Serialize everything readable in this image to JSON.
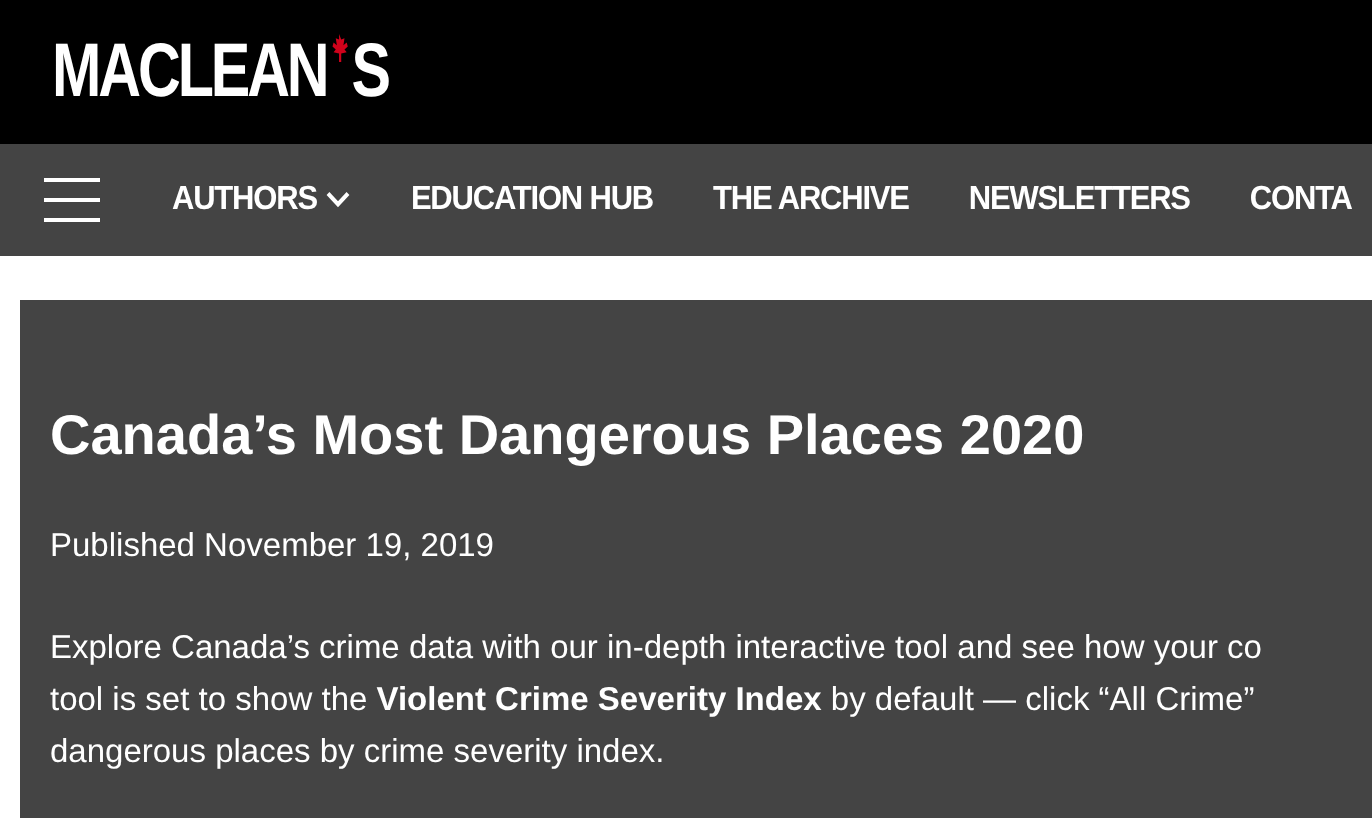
{
  "logo": {
    "text_before": "MACLEAN",
    "text_after": "S"
  },
  "nav": {
    "items": [
      {
        "label": "AUTHORS",
        "has_dropdown": true
      },
      {
        "label": "EDUCATION HUB",
        "has_dropdown": false
      },
      {
        "label": "THE ARCHIVE",
        "has_dropdown": false
      },
      {
        "label": "NEWSLETTERS",
        "has_dropdown": false
      },
      {
        "label": "CONTA",
        "has_dropdown": false
      }
    ]
  },
  "article": {
    "title": "Canada’s Most Dangerous Places 2020",
    "published": "Published November 19, 2019",
    "intro_lines": [
      "Explore Canada’s crime data with our in-depth interactive tool and see how your co",
      "tool is set to show the **Violent Crime Severity Index** by default — click “All Crime”",
      "dangerous places by crime severity index."
    ]
  }
}
